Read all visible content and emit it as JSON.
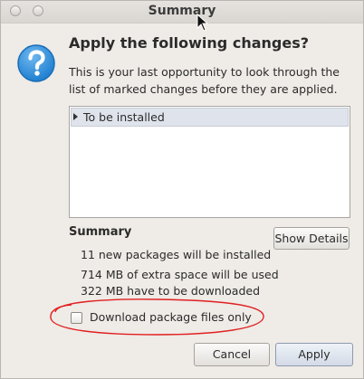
{
  "window": {
    "title": "Summary"
  },
  "dialog": {
    "heading": "Apply the following changes?",
    "description": "This is your last opportunity to look through the list of marked changes before they are applied.",
    "icon": "question-icon"
  },
  "changes_list": {
    "rows": [
      {
        "label": "To be installed",
        "expanded": false
      }
    ]
  },
  "summary": {
    "title": "Summary",
    "lines": [
      "11 new packages will be installed",
      "714 MB of extra space will be used",
      "322 MB have to be downloaded"
    ],
    "show_details_label": "Show Details"
  },
  "download_only": {
    "label": "Download package files only",
    "checked": false
  },
  "buttons": {
    "cancel_label": "Cancel",
    "apply_label": "Apply"
  },
  "colors": {
    "annotation_red": "#e02020",
    "icon_blue": "#2f8fdc",
    "selection_bg": "#dfe4ec"
  }
}
